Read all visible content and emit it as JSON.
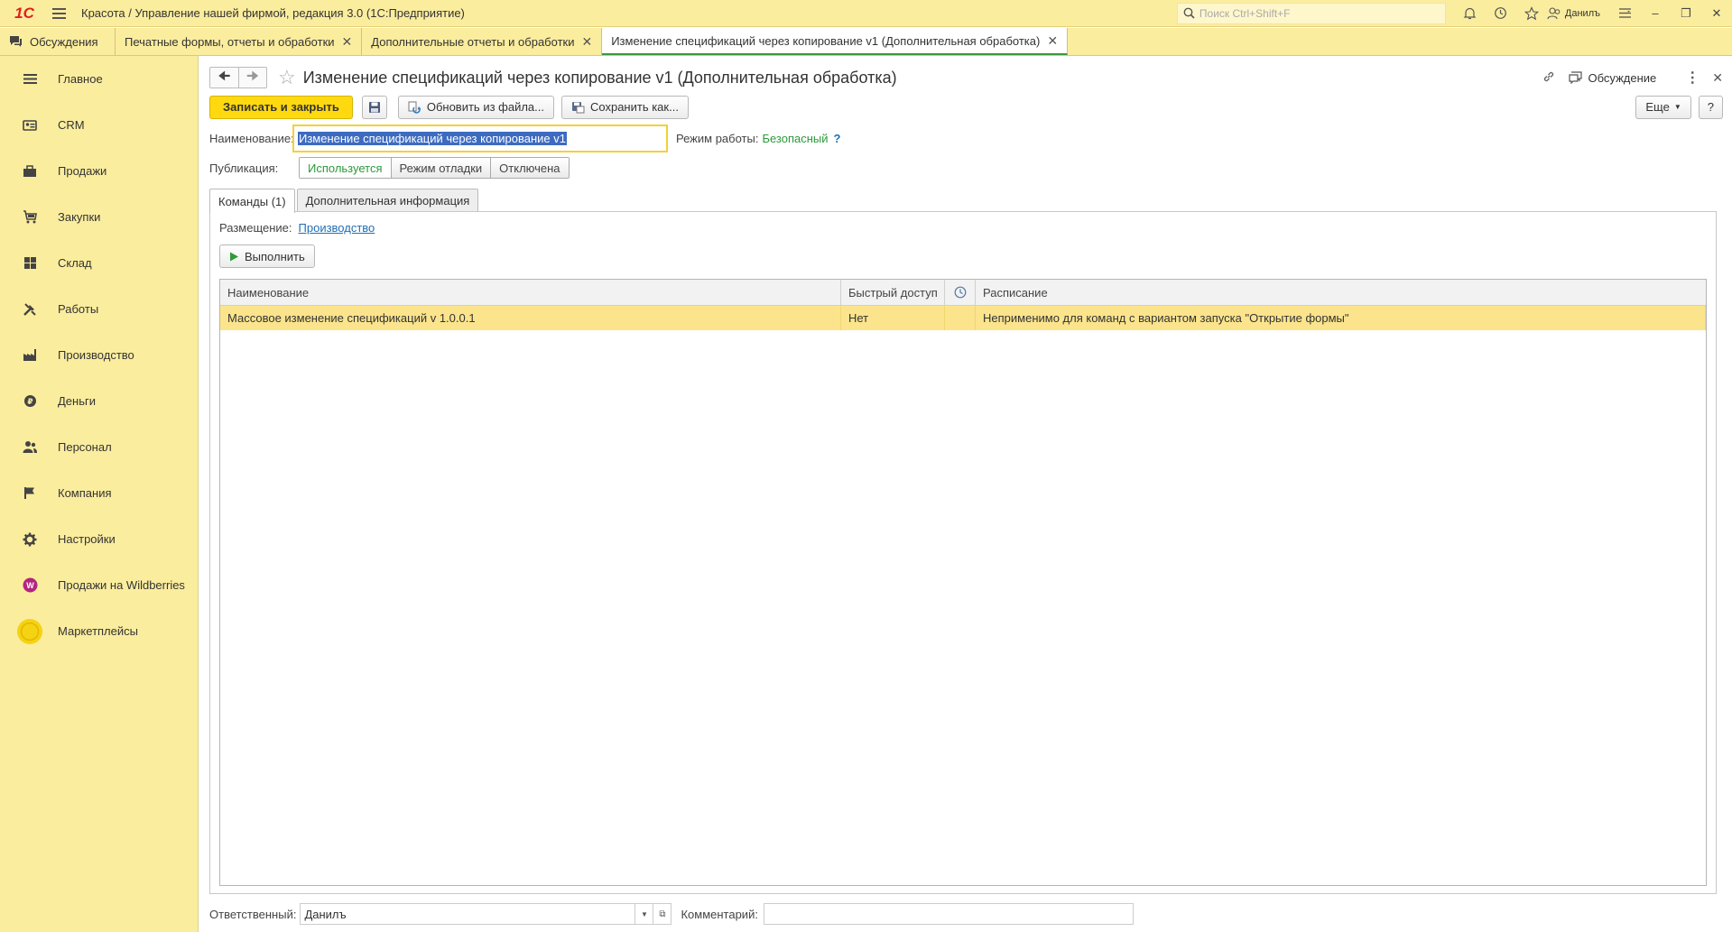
{
  "app": {
    "logo": "1С",
    "title": "Красота / Управление нашей фирмой, редакция 3.0  (1С:Предприятие)",
    "search_placeholder": "Поиск Ctrl+Shift+F",
    "user": "Данилъ"
  },
  "tabs": [
    {
      "label": "Обсуждения"
    },
    {
      "label": "Печатные формы, отчеты и обработки"
    },
    {
      "label": "Дополнительные отчеты и обработки"
    },
    {
      "label": "Изменение спецификаций через копирование v1 (Дополнительная обработка)"
    }
  ],
  "sidebar": [
    {
      "label": "Главное",
      "icon": "menu-icon"
    },
    {
      "label": "CRM",
      "icon": "crm-icon"
    },
    {
      "label": "Продажи",
      "icon": "sales-icon"
    },
    {
      "label": "Закупки",
      "icon": "purchases-icon"
    },
    {
      "label": "Склад",
      "icon": "warehouse-icon"
    },
    {
      "label": "Работы",
      "icon": "works-icon"
    },
    {
      "label": "Производство",
      "icon": "production-icon"
    },
    {
      "label": "Деньги",
      "icon": "money-icon"
    },
    {
      "label": "Персонал",
      "icon": "personnel-icon"
    },
    {
      "label": "Компания",
      "icon": "company-icon"
    },
    {
      "label": "Настройки",
      "icon": "settings-icon"
    },
    {
      "label": "Продажи на Wildberries",
      "icon": "wildberries-icon"
    },
    {
      "label": "Маркетплейсы",
      "icon": "marketplaces-icon"
    }
  ],
  "form": {
    "title": "Изменение спецификаций через копирование v1 (Дополнительная обработка)",
    "discussion": "Обсуждение",
    "toolbar": {
      "save_close": "Записать и закрыть",
      "update_from_file": "Обновить из файла...",
      "save_as": "Сохранить как...",
      "more": "Еще",
      "help": "?"
    },
    "name_label": "Наименование:",
    "name_value": "Изменение спецификаций через копирование v1",
    "mode_label": "Режим работы:",
    "mode_value": "Безопасный",
    "mode_help": "?",
    "publication_label": "Публикация:",
    "publication_options": [
      "Используется",
      "Режим отладки",
      "Отключена"
    ],
    "publication_selected": "Используется",
    "form_tabs": [
      "Команды (1)",
      "Дополнительная информация"
    ],
    "placement_label": "Размещение:",
    "placement_value": "Производство",
    "run_button": "Выполнить",
    "table": {
      "columns": [
        "Наименование",
        "Быстрый доступ",
        "",
        "Расписание"
      ],
      "rows": [
        {
          "name": "Массовое изменение спецификаций v 1.0.0.1",
          "quick": "Нет",
          "flag": "",
          "schedule": "Неприменимо для команд с вариантом запуска \"Открытие формы\""
        }
      ]
    },
    "responsible_label": "Ответственный:",
    "responsible_value": "Данилъ",
    "comment_label": "Комментарий:",
    "comment_value": ""
  }
}
